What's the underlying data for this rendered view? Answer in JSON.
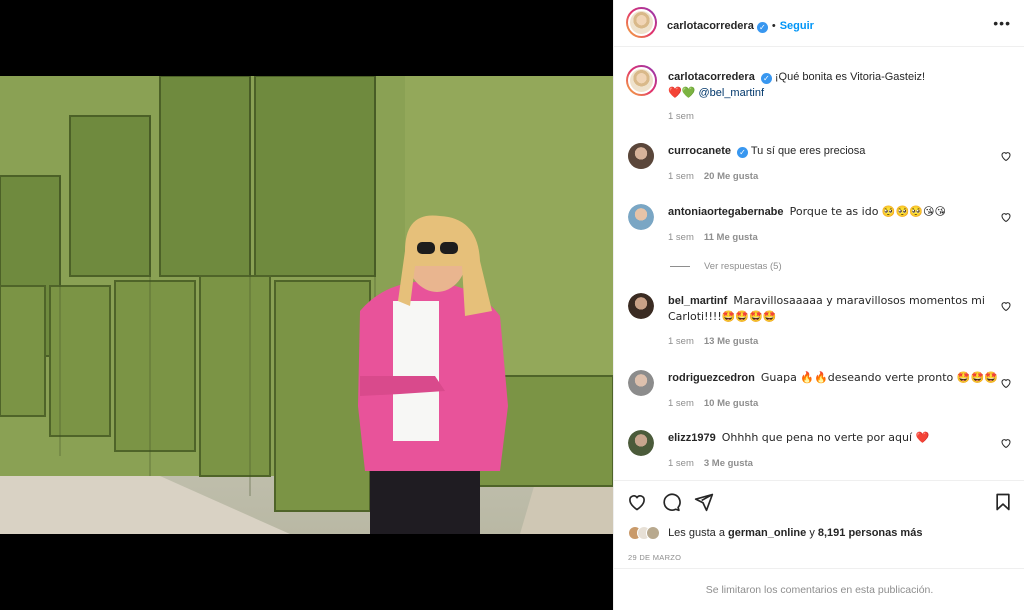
{
  "post": {
    "author": "carlotacorredera",
    "follow_label": "Seguir",
    "separator": "•",
    "more_icon": "more-options-icon",
    "caption": {
      "text": "¡Qué bonita es Vitoria-Gasteiz!",
      "emoji": "❤️💚",
      "mention": "@bel_martinf",
      "time": "1 sem"
    },
    "photo": {
      "description_letters": "VITORIA-GASTEIZ hedge letters"
    }
  },
  "comments": [
    {
      "user": "currocanete",
      "verified": true,
      "text": "Tu sí que eres preciosa",
      "time": "1 sem",
      "likes": "20 Me gusta"
    },
    {
      "user": "antoniaortegabernabe",
      "verified": false,
      "text": "Porque te as ido 🥺🥺🥺😘😘",
      "time": "1 sem",
      "likes": "11 Me gusta"
    },
    {
      "user": "bel_martinf",
      "verified": false,
      "text": "Maravillosaaaaa y maravillosos momentos mi Carloti!!!!🤩🤩🤩🤩",
      "time": "1 sem",
      "likes": "13 Me gusta"
    },
    {
      "user": "rodriguezcedron",
      "verified": false,
      "text": "Guapa 🔥🔥deseando verte pronto 🤩🤩🤩",
      "time": "1 sem",
      "likes": "10 Me gusta"
    },
    {
      "user": "elizz1979",
      "verified": false,
      "text": "Ohhhh que pena no verte por aquí ❤️",
      "time": "1 sem",
      "likes": "3 Me gusta"
    }
  ],
  "view_replies": "Ver respuestas (5)",
  "likes": {
    "prefix": "Les gusta a",
    "user": "german_online",
    "connector": "y",
    "count": "8,191 personas más"
  },
  "date": "29 DE MARZO",
  "comments_limited": "Se limitaron los comentarios en esta publicación.",
  "colors": {
    "link_blue": "#0095f6",
    "verified_blue": "#3897f0",
    "muted": "#8e8e8e",
    "text": "#262626",
    "blazer_pink": "#e8539a",
    "hedge_green": "#7f9a4a"
  }
}
